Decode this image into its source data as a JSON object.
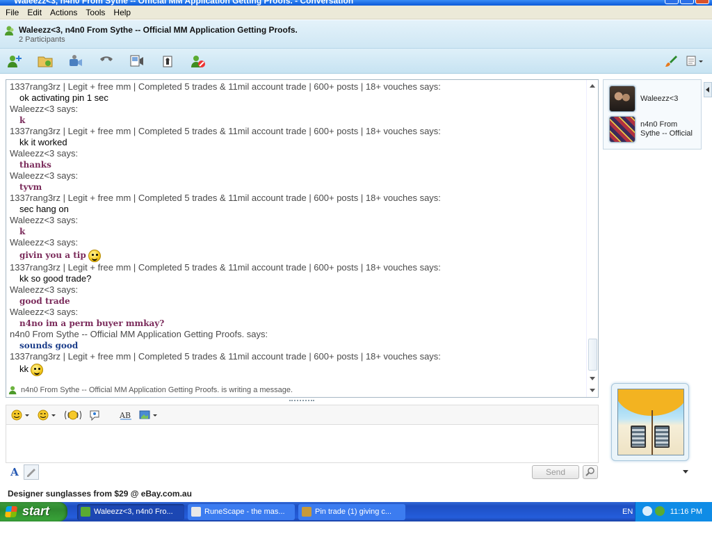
{
  "window": {
    "title": "Waleezz<3, n4n0 From Sythe -- Official MM Application Getting Proofs. - Conversation"
  },
  "menu": [
    "File",
    "Edit",
    "Actions",
    "Tools",
    "Help"
  ],
  "conversation": {
    "title": "Waleezz<3, n4n0 From Sythe -- Official MM Application Getting Proofs.",
    "participants_count": "2 Participants"
  },
  "toolbar": {
    "icons": [
      "invite-contact-icon",
      "share-files-icon",
      "video-call-icon",
      "phone-call-icon",
      "activities-icon",
      "games-icon",
      "block-contact-icon",
      "theme-brush-icon",
      "more-options-icon"
    ]
  },
  "messages": [
    {
      "who": "1337rang3rz | Legit + free mm | Completed 5 trades & 11mil account trade | 600+ posts | 18+ vouches says:",
      "text": "ok activating pin 1 sec",
      "style": "plain"
    },
    {
      "who": "Waleezz<3 says:",
      "text": "k",
      "style": "waleezz"
    },
    {
      "who": "1337rang3rz | Legit + free mm | Completed 5 trades & 11mil account trade | 600+ posts | 18+ vouches says:",
      "text": "kk it worked",
      "style": "plain"
    },
    {
      "who": "Waleezz<3 says:",
      "text": "thanks",
      "style": "waleezz"
    },
    {
      "who": "Waleezz<3 says:",
      "text": "tyvm",
      "style": "waleezz"
    },
    {
      "who": "1337rang3rz | Legit + free mm | Completed 5 trades & 11mil account trade | 600+ posts | 18+ vouches says:",
      "text": "sec hang on",
      "style": "plain"
    },
    {
      "who": "Waleezz<3 says:",
      "text": "k",
      "style": "waleezz"
    },
    {
      "who": "Waleezz<3 says:",
      "text": "givin you a tip",
      "style": "waleezz",
      "emoticon": "drool-emoticon"
    },
    {
      "who": "1337rang3rz | Legit + free mm | Completed 5 trades & 11mil account trade | 600+ posts | 18+ vouches says:",
      "text": "kk so good trade?",
      "style": "plain"
    },
    {
      "who": "Waleezz<3 says:",
      "text": "good trade",
      "style": "waleezz"
    },
    {
      "who": "Waleezz<3 says:",
      "text": "n4no im a perm buyer mmkay?",
      "style": "waleezz"
    },
    {
      "who": "n4n0 From Sythe -- Official MM Application Getting Proofs. says:",
      "text": "sounds good",
      "style": "nano"
    },
    {
      "who": "1337rang3rz | Legit + free mm | Completed 5 trades & 11mil account trade | 600+ posts | 18+ vouches says:",
      "text": "kk",
      "style": "plain",
      "emoticon": "smile-emoticon"
    }
  ],
  "status_message": "n4n0 From Sythe -- Official MM Application Getting Proofs. is writing a message.",
  "formatting": {
    "icons": [
      "emoticons-icon",
      "winks-icon",
      "nudge-icon",
      "voice-clip-icon",
      "spellcheck-icon",
      "send-image-icon"
    ]
  },
  "input": {
    "value": ""
  },
  "send_button": "Send",
  "ad_text": "Designer sunglasses from $29 @ eBay.com.au",
  "participants": [
    {
      "name": "Waleezz<3"
    },
    {
      "name": "n4n0 From Sythe -- Official"
    }
  ],
  "taskbar": {
    "start": "start",
    "tasks": [
      {
        "label": "Waleezz<3, n4n0 Fro...",
        "active": true
      },
      {
        "label": "RuneScape - the mas...",
        "active": false
      },
      {
        "label": "Pin trade (1) giving c...",
        "active": false
      }
    ],
    "language": "EN",
    "clock": "11:16 PM"
  },
  "colors": {
    "waleezz_text": "#7a2a5a",
    "nano_text": "#1b3d8a",
    "taskbar": "#245ddb",
    "start": "#3aa53a"
  }
}
